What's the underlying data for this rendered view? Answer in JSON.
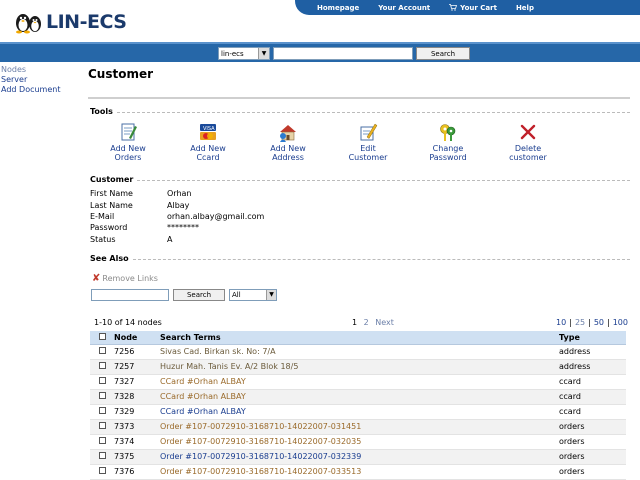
{
  "brand": {
    "logo_text": "LIN-ECS"
  },
  "topnav": [
    "Homepage",
    "Your Account",
    "Your Cart",
    "Help"
  ],
  "search": {
    "select_value": "lin-ecs",
    "button": "Search"
  },
  "sidebar": [
    "Nodes",
    "Server",
    "Add Document"
  ],
  "page": {
    "title": "Customer"
  },
  "tools": {
    "title": "Tools",
    "items": [
      {
        "line1": "Add New",
        "line2": "Orders",
        "icon": "add-order-icon"
      },
      {
        "line1": "Add New",
        "line2": "Ccard",
        "icon": "credit-card-icon"
      },
      {
        "line1": "Add New",
        "line2": "Address",
        "icon": "add-address-icon"
      },
      {
        "line1": "Edit",
        "line2": "Customer",
        "icon": "edit-icon"
      },
      {
        "line1": "Change",
        "line2": "Password",
        "icon": "keys-icon"
      },
      {
        "line1": "Delete",
        "line2": "customer",
        "icon": "delete-icon"
      }
    ]
  },
  "customer": {
    "title": "Customer",
    "fields": [
      {
        "label": "First Name",
        "value": "Orhan"
      },
      {
        "label": "Last Name",
        "value": "Albay"
      },
      {
        "label": "E-Mail",
        "value": "orhan.albay@gmail.com"
      },
      {
        "label": "Password",
        "value": "********"
      },
      {
        "label": "Status",
        "value": "A"
      }
    ]
  },
  "see_also": {
    "title": "See Also",
    "remove_links": "Remove Links",
    "search_button": "Search",
    "filter_value": "All"
  },
  "pager": {
    "count": "1-10 of 14 nodes",
    "current": "1",
    "page2": "2",
    "next": "Next",
    "sizes": [
      "10",
      "25",
      "50",
      "100"
    ]
  },
  "table": {
    "headers": [
      "Node",
      "Search Terms",
      "Type"
    ],
    "rows": [
      {
        "node": "7256",
        "terms": "Sivas Cad. Birkan sk. No: 7/A",
        "type": "address",
        "cls": "addr"
      },
      {
        "node": "7257",
        "terms": "Huzur Mah. Tanis Ev. A/2 Blok 18/5",
        "type": "address",
        "cls": "addr"
      },
      {
        "node": "7327",
        "terms": "CCard #Orhan ALBAY",
        "type": "ccard",
        "cls": "order"
      },
      {
        "node": "7328",
        "terms": "CCard #Orhan ALBAY",
        "type": "ccard",
        "cls": "order"
      },
      {
        "node": "7329",
        "terms": "CCard #Orhan ALBAY",
        "type": "ccard",
        "cls": "ccard"
      },
      {
        "node": "7373",
        "terms": "Order #107-0072910-3168710-14022007-031451",
        "type": "orders",
        "cls": "order"
      },
      {
        "node": "7374",
        "terms": "Order #107-0072910-3168710-14022007-032035",
        "type": "orders",
        "cls": "order"
      },
      {
        "node": "7375",
        "terms": "Order #107-0072910-3168710-14022007-032339",
        "type": "orders",
        "cls": "order dk"
      },
      {
        "node": "7376",
        "terms": "Order #107-0072910-3168710-14022007-033513",
        "type": "orders",
        "cls": "order"
      }
    ]
  }
}
